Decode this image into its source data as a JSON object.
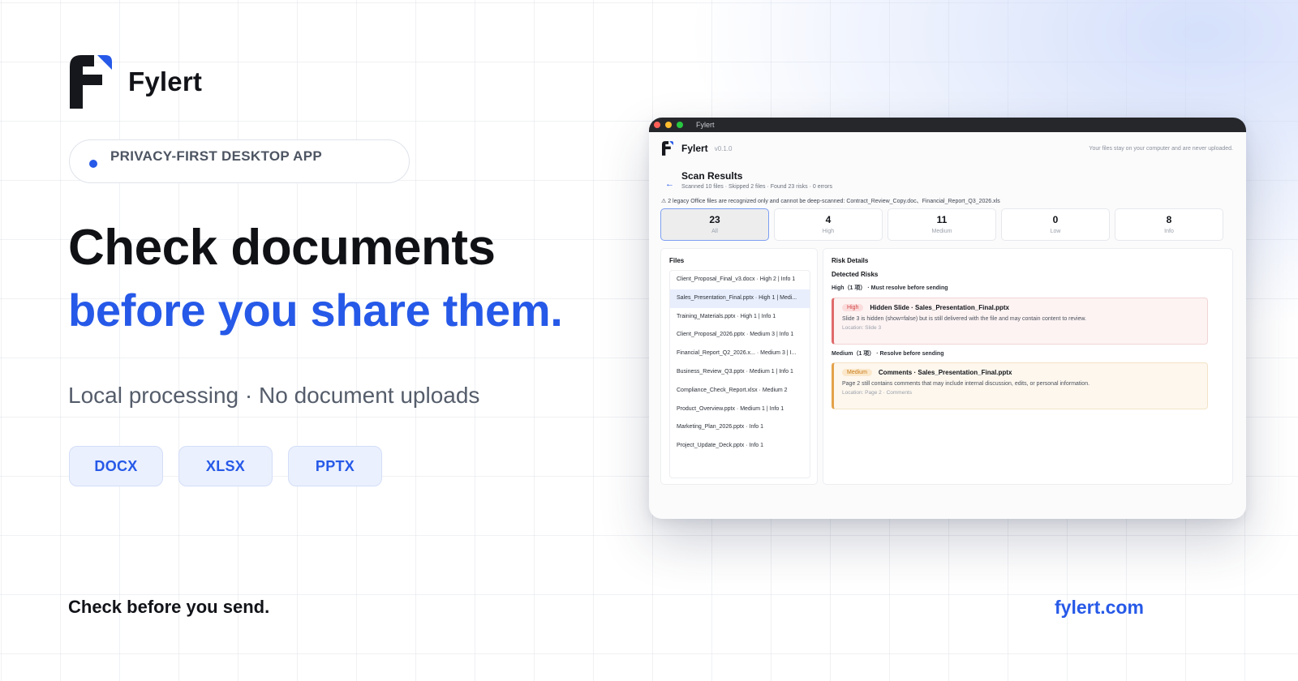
{
  "brand": {
    "name": "Fylert"
  },
  "badge_pill": {
    "text": "PRIVACY-FIRST DESKTOP APP"
  },
  "hero": {
    "line1": "Check documents",
    "line2": "before you share them.",
    "subtitle": "Local processing · No document uploads"
  },
  "formats": [
    "DOCX",
    "XLSX",
    "PPTX"
  ],
  "footer": {
    "tagline": "Check before you send.",
    "site": "fylert.com"
  },
  "colors": {
    "accent": "#2659e8",
    "high": "#d24444",
    "medium": "#c97a17"
  },
  "app": {
    "window_title": "Fylert",
    "name": "Fylert",
    "version": "v0.1.0",
    "privacy_note": "Your files stay on your computer and are never uploaded.",
    "back_icon": "arrow-left-icon",
    "results_title": "Scan Results",
    "results_stats": "Scanned 10 files · Skipped 2 files · Found 23 risks · 0 errors",
    "warning": "⚠ 2 legacy Office files are recognized only and cannot be deep-scanned: Contract_Review_Copy.doc、Financial_Report_Q3_2026.xls",
    "stats": [
      {
        "value": "23",
        "label": "All",
        "active": true
      },
      {
        "value": "4",
        "label": "High",
        "active": false
      },
      {
        "value": "11",
        "label": "Medium",
        "active": false
      },
      {
        "value": "0",
        "label": "Low",
        "active": false
      },
      {
        "value": "8",
        "label": "Info",
        "active": false
      }
    ],
    "files_title": "Files",
    "files": [
      "Client_Proposal_Final_v3.docx · High 2 | Info 1",
      "Sales_Presentation_Final.pptx · High 1 | Medi...",
      "Training_Materials.pptx · High 1 | Info 1",
      "Client_Proposal_2026.pptx · Medium 3 | Info 1",
      "Financial_Report_Q2_2026.x... · Medium 3 | I...",
      "Business_Review_Q3.pptx · Medium 1 | Info 1",
      "Compliance_Check_Report.xlsx · Medium 2",
      "Product_Overview.pptx · Medium 1 | Info 1",
      "Marketing_Plan_2026.pptx · Info 1",
      "Project_Update_Deck.pptx · Info 1"
    ],
    "selected_file_index": 1,
    "risk": {
      "title": "Risk Details",
      "subtitle": "Detected Risks",
      "high_group": "High（1 项） · Must resolve before sending",
      "high_card": {
        "badge": "High",
        "title": "Hidden Slide · Sales_Presentation_Final.pptx",
        "desc": "Slide 3 is hidden (show=false) but is still delivered with the file and may contain content to review.",
        "location": "Location: Slide 3"
      },
      "medium_group": "Medium（1 项） · Resolve before sending",
      "medium_card": {
        "badge": "Medium",
        "title": "Comments · Sales_Presentation_Final.pptx",
        "desc": "Page 2 still contains comments that may include internal discussion, edits, or personal information.",
        "location": "Location: Page 2 · Comments"
      }
    }
  }
}
